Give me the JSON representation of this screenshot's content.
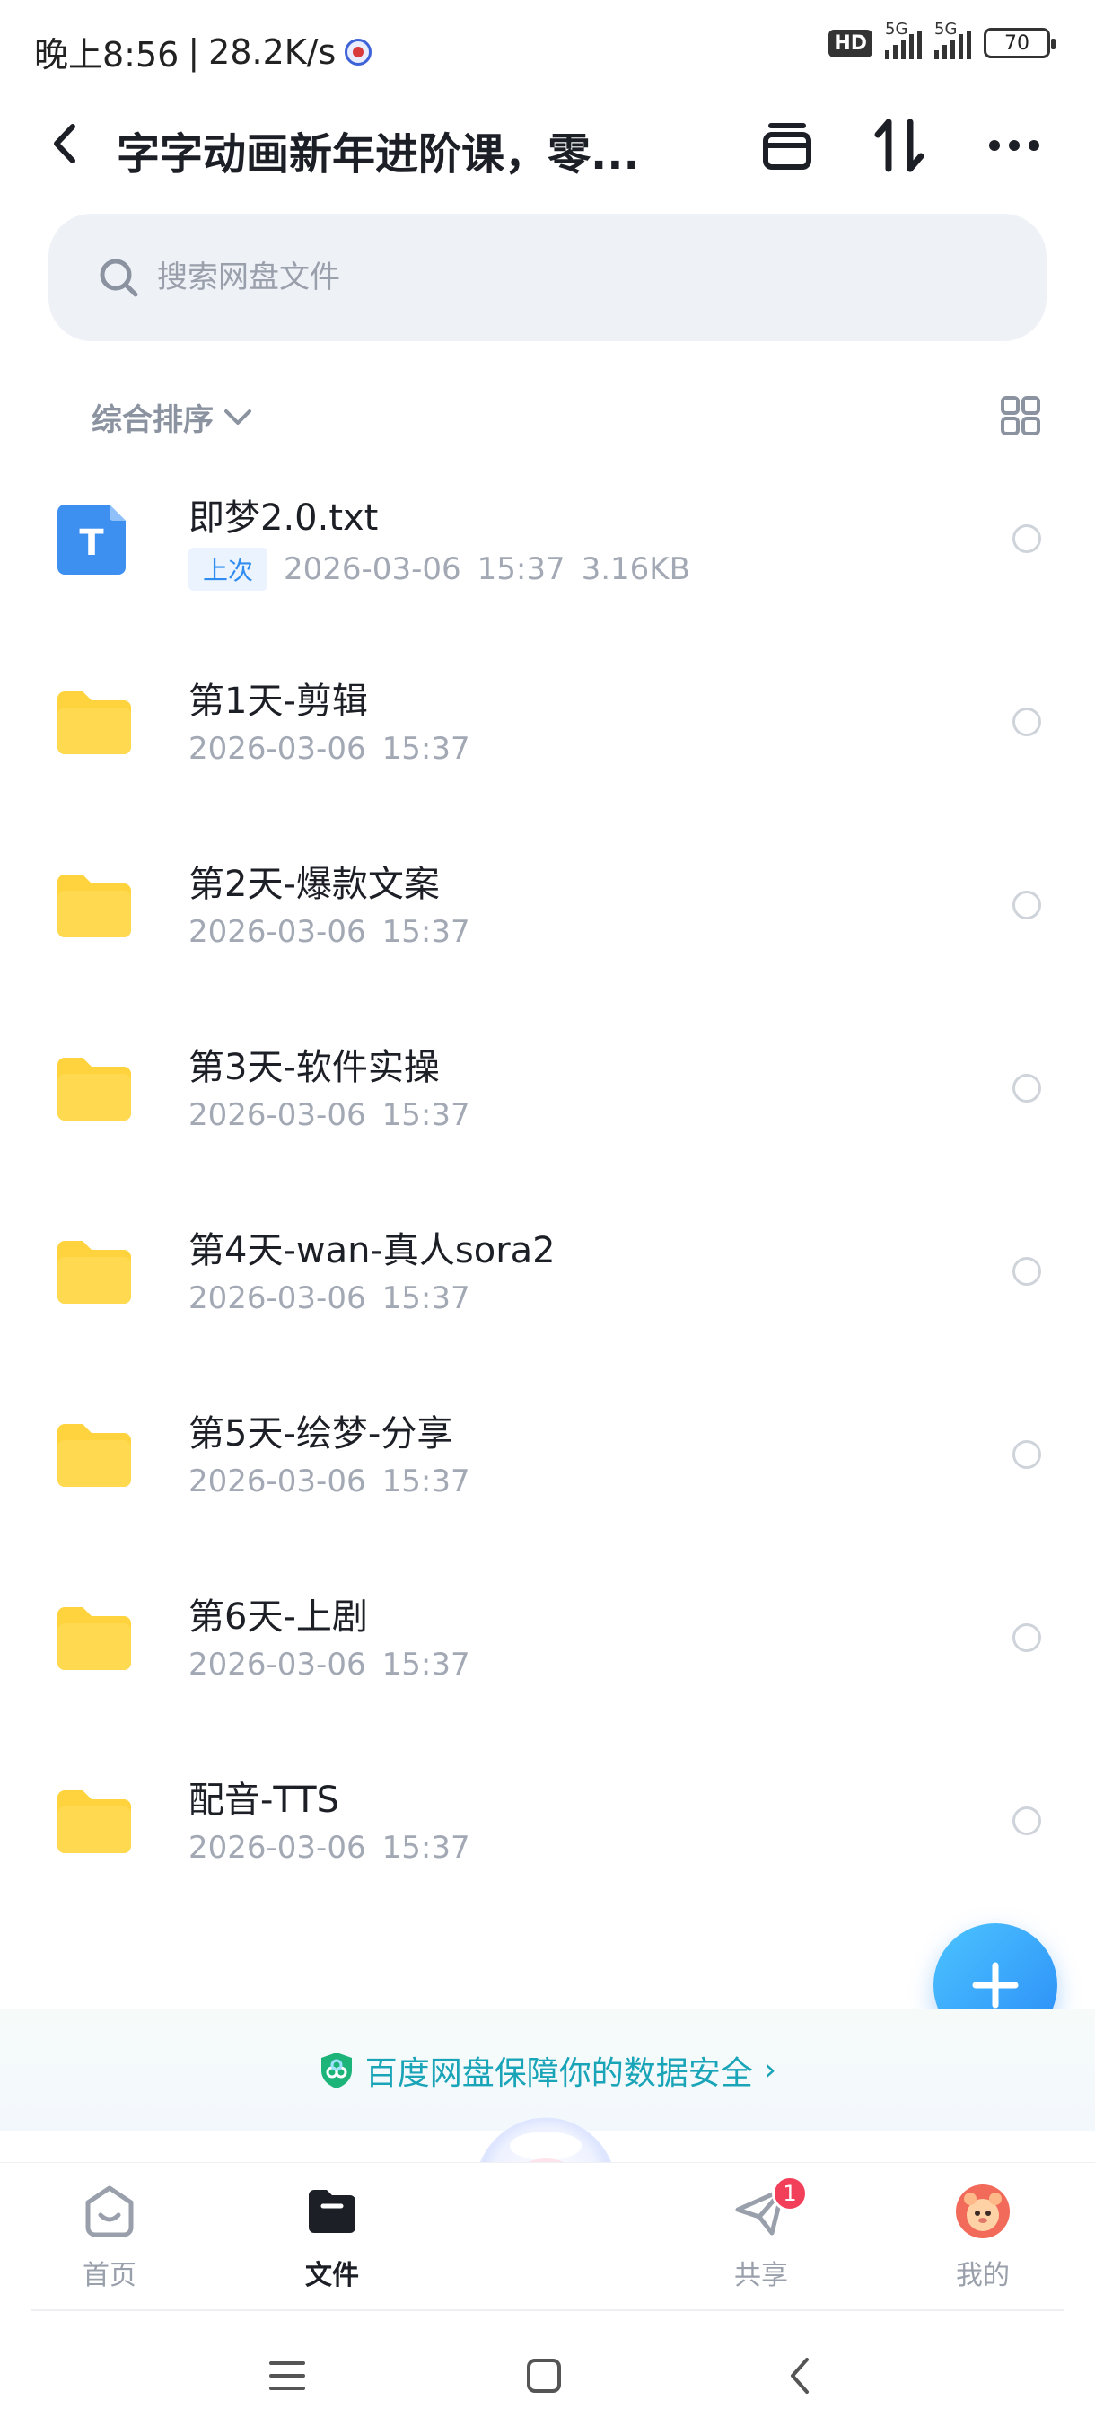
{
  "status_bar": {
    "time": "晚上8:56",
    "separator": "|",
    "net_speed": "28.2K/s",
    "hd_badge": "HD",
    "signal1_label": "5G",
    "signal2_label": "5G",
    "battery": "70"
  },
  "header": {
    "title": "字字动画新年进阶课，零..."
  },
  "search": {
    "placeholder": "搜索网盘文件"
  },
  "sort": {
    "label": "综合排序"
  },
  "files": [
    {
      "name": "即梦2.0.txt",
      "type": "txt",
      "tag": "上次",
      "date": "2026-03-06",
      "time": "15:37",
      "size": "3.16KB",
      "icon_letter": "T"
    },
    {
      "name": "第1天-剪辑",
      "type": "folder",
      "date": "2026-03-06",
      "time": "15:37"
    },
    {
      "name": "第2天-爆款文案",
      "type": "folder",
      "date": "2026-03-06",
      "time": "15:37"
    },
    {
      "name": "第3天-软件实操",
      "type": "folder",
      "date": "2026-03-06",
      "time": "15:37"
    },
    {
      "name": "第4天-wan-真人sora2",
      "type": "folder",
      "date": "2026-03-06",
      "time": "15:37"
    },
    {
      "name": "第5天-绘梦-分享",
      "type": "folder",
      "date": "2026-03-06",
      "time": "15:37"
    },
    {
      "name": "第6天-上剧",
      "type": "folder",
      "date": "2026-03-06",
      "time": "15:37"
    },
    {
      "name": "配音-TTS",
      "type": "folder",
      "date": "2026-03-06",
      "time": "15:37"
    }
  ],
  "security_banner": {
    "text": "百度网盘保障你的数据安全",
    "chevron": "›"
  },
  "bottom_nav": {
    "home": "首页",
    "files": "文件",
    "share": "共享",
    "share_badge": "1",
    "me": "我的"
  },
  "colors": {
    "accent": "#2f8cf0",
    "folder": "#ffd33d",
    "security": "#1aa4b8",
    "badge": "#f2405a"
  },
  "icons": [
    "back-arrow-icon",
    "archive-icon",
    "sort-arrows-icon",
    "more-icon",
    "search-icon",
    "chevron-down-icon",
    "grid-view-icon",
    "folder-icon",
    "text-file-icon",
    "plus-icon",
    "shield-icon",
    "home-icon",
    "folder-nav-icon",
    "paper-plane-icon",
    "avatar-icon",
    "menu-icon",
    "square-icon",
    "back-icon"
  ]
}
